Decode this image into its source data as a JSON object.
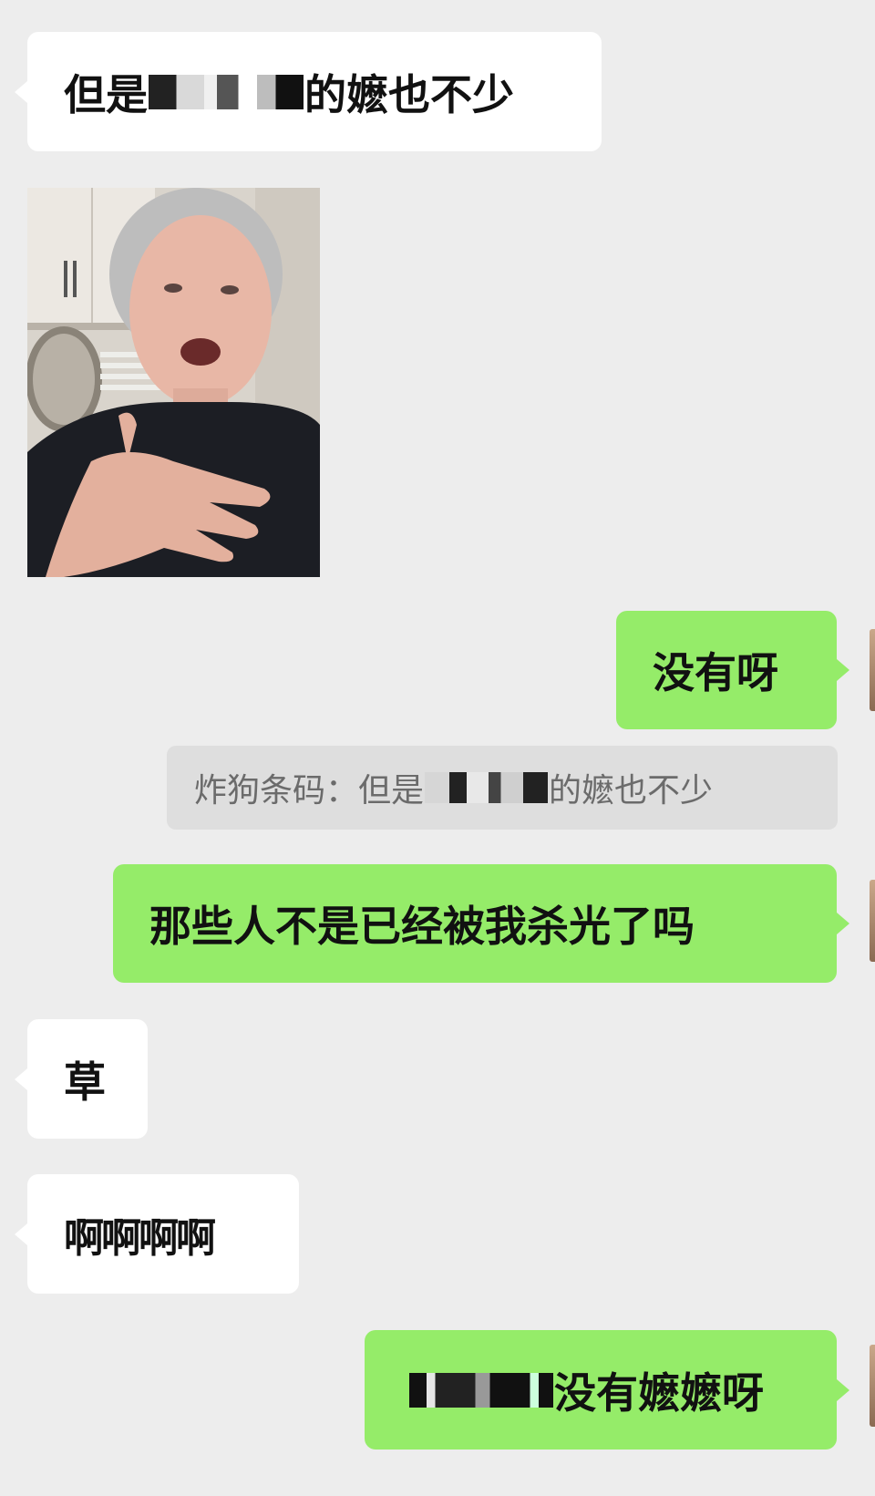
{
  "messages": {
    "m1_text_before": "但是",
    "m1_text_after": "的嬷也不少",
    "m3_text": "没有呀",
    "quote_text_before": "炸狗条码：但是",
    "quote_text_after": "的嬷也不少",
    "m4_text": "那些人不是已经被我杀光了吗",
    "m5_text": "草",
    "m6_text": "啊啊啊啊",
    "m7_text": "没有嬷嬷呀"
  },
  "colors": {
    "background": "#ededed",
    "incoming_bubble": "#ffffff",
    "outgoing_bubble": "#95ec69",
    "quote_bg": "#dedede"
  },
  "icons": [
    "redacted-mosaic",
    "avatar"
  ]
}
